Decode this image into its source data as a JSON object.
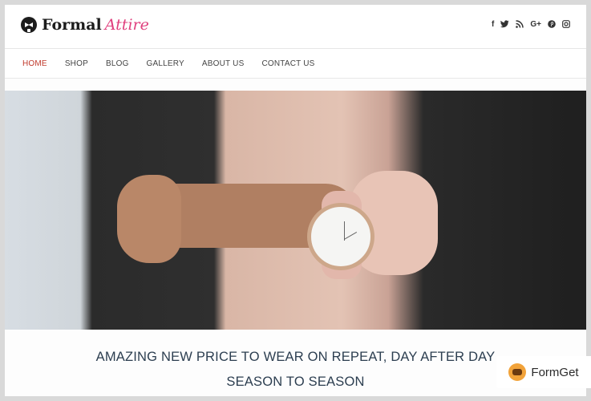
{
  "brand": {
    "logo_word1": "Formal",
    "logo_word2": "Attire"
  },
  "socials": [
    "f",
    "t",
    "rss",
    "G+",
    "p",
    "ig"
  ],
  "nav": {
    "items": [
      {
        "label": "HOME"
      },
      {
        "label": "SHOP"
      },
      {
        "label": "BLOG"
      },
      {
        "label": "GALLERY"
      },
      {
        "label": "ABOUT US"
      },
      {
        "label": "CONTACT US"
      }
    ]
  },
  "tagline": {
    "line1": "AMAZING NEW PRICE TO WEAR ON REPEAT, DAY AFTER DAY",
    "line2": "SEASON TO SEASON"
  },
  "badge": {
    "text": "FormGet"
  },
  "colors": {
    "accent_nav": "#c0392b",
    "brand_pink": "#e0407e",
    "heading": "#2c3e50"
  }
}
